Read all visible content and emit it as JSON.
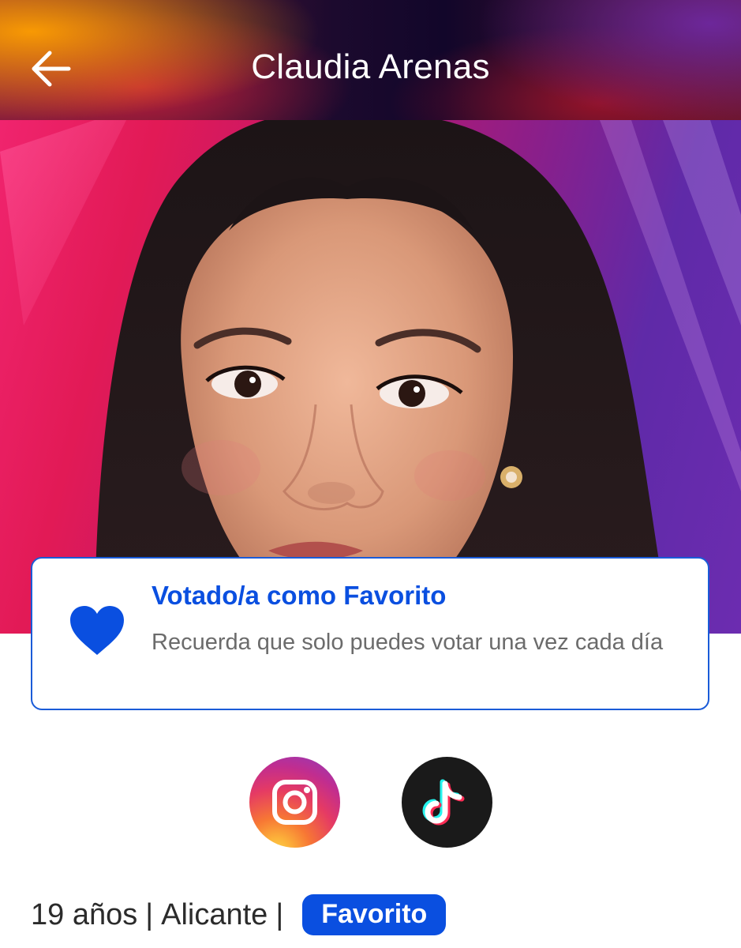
{
  "header": {
    "title": "Claudia Arenas",
    "back_icon": "arrow-left-icon"
  },
  "hero": {
    "image": "contestant-portrait-photo"
  },
  "vote_card": {
    "icon": "heart-icon",
    "title": "Votado/a como Favorito",
    "subtitle": "Recuerda que solo puedes votar una vez cada día",
    "accent_color": "#0a4fe0"
  },
  "social": {
    "instagram_icon": "instagram-icon",
    "tiktok_icon": "tiktok-icon"
  },
  "info": {
    "age": "19 años",
    "separator": "|",
    "city": "Alicante",
    "badge": "Favorito"
  }
}
